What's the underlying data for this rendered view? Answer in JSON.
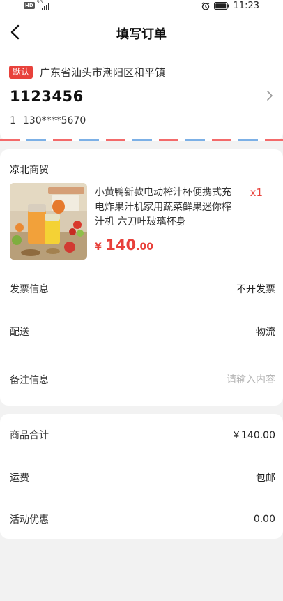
{
  "status_bar": {
    "hd": "HD",
    "signal": "5G",
    "time": "11:23"
  },
  "nav": {
    "title": "填写订单"
  },
  "address": {
    "default_tag": "默认",
    "region": "广东省汕头市潮阳区和平镇",
    "name": "1123456",
    "contact_label": "1",
    "phone": "130****5670"
  },
  "order": {
    "store": "凉北商贸",
    "product": {
      "title": "小黄鸭新款电动榨汁杯便携式充电炸果汁机家用蔬菜鲜果迷你榨汁机 六刀叶玻璃杯身",
      "qty": "x1",
      "price_symbol": "¥",
      "price_int": "140",
      "price_dec": ".00"
    },
    "invoice": {
      "label": "发票信息",
      "value": "不开发票"
    },
    "delivery": {
      "label": "配送",
      "value": "物流"
    },
    "remark": {
      "label": "备注信息",
      "placeholder": "请输入内容"
    }
  },
  "summary": {
    "goods_total": {
      "label": "商品合计",
      "value": "￥140.00"
    },
    "shipping": {
      "label": "运费",
      "value": "包邮"
    },
    "discount": {
      "label": "活动优惠",
      "value": "0.00"
    }
  },
  "colors": {
    "accent": "#e8413b",
    "background": "#f2f2f2",
    "card": "#ffffff"
  },
  "icons": {
    "back": "back-arrow-icon",
    "chevron": "chevron-right-icon",
    "alarm": "alarm-icon",
    "battery": "battery-icon"
  }
}
